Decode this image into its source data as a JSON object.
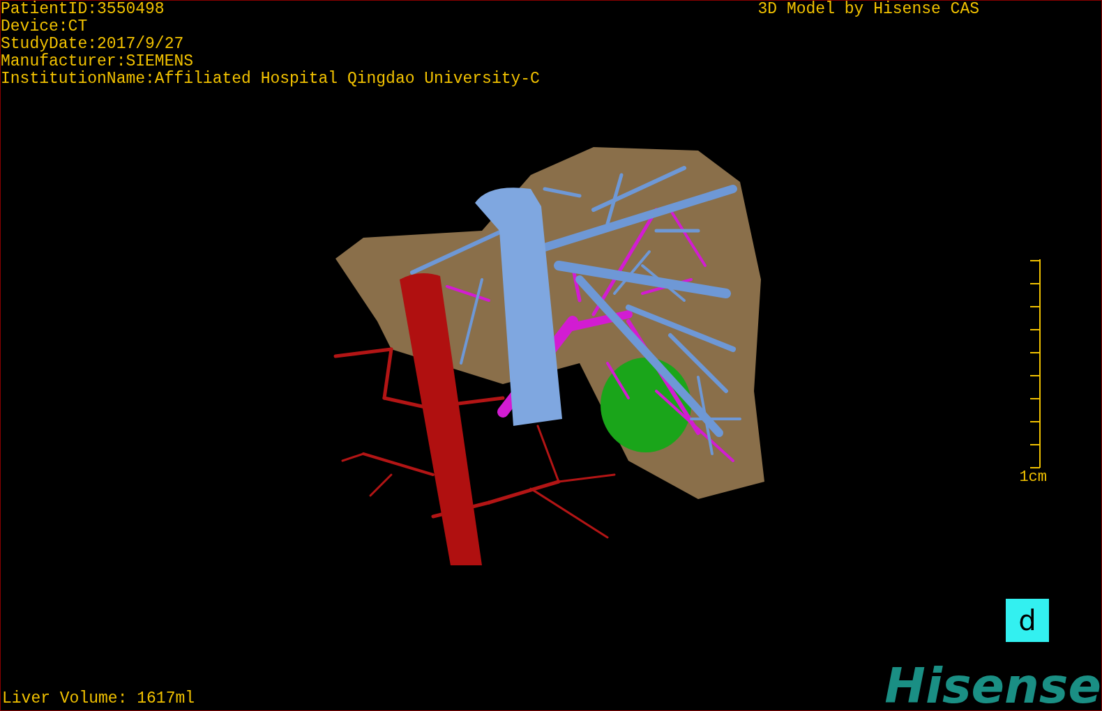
{
  "header": {
    "info_lines": [
      "PatientID:3550498",
      "Device:CT",
      "StudyDate:2017/9/27",
      "Manufacturer:SIEMENS",
      "InstitutionName:Affiliated Hospital Qingdao University-C"
    ],
    "title": "3D Model by Hisense CAS"
  },
  "scale_bar": {
    "label": "1cm"
  },
  "panel_label": "d",
  "footer": {
    "volume": "Liver Volume: 1617ml"
  },
  "logo": "Hisense"
}
